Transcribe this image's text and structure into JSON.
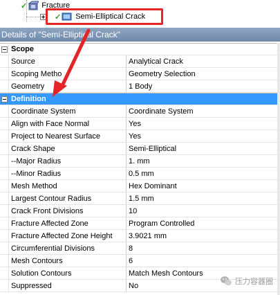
{
  "tree": {
    "parent_label": "Fracture",
    "child_label": "Semi-Elliptical Crack"
  },
  "details": {
    "title": "Details of \"Semi-Elliptical Crack\""
  },
  "groups": {
    "scope": "Scope",
    "definition": "Definition"
  },
  "scope_rows": [
    {
      "name": "Source",
      "value": "Analytical Crack"
    },
    {
      "name": "Scoping Metho",
      "value": "Geometry Selection"
    },
    {
      "name": "Geometry",
      "value": "1 Body"
    }
  ],
  "definition_rows": [
    {
      "name": "Coordinate System",
      "value": "Coordinate System"
    },
    {
      "name": "Align with Face Normal",
      "value": "Yes"
    },
    {
      "name": "Project to Nearest Surface",
      "value": "Yes"
    },
    {
      "name": "Crack Shape",
      "value": "Semi-Elliptical"
    },
    {
      "name": "--Major Radius",
      "value": "1. mm"
    },
    {
      "name": "--Minor Radius",
      "value": "0.5 mm"
    },
    {
      "name": "Mesh Method",
      "value": "Hex Dominant"
    },
    {
      "name": "Largest Contour Radius",
      "value": "1.5 mm"
    },
    {
      "name": "Crack Front Divisions",
      "value": "10"
    },
    {
      "name": "Fracture Affected Zone",
      "value": "Program Controlled"
    },
    {
      "name": "Fracture Affected Zone Height",
      "value": "3.9021 mm"
    },
    {
      "name": "Circumferential Divisions",
      "value": "8"
    },
    {
      "name": "Mesh Contours",
      "value": "6"
    },
    {
      "name": "Solution Contours",
      "value": "Match Mesh Contours"
    },
    {
      "name": "Suppressed",
      "value": "No"
    }
  ],
  "watermark": "压力容器圈",
  "icons": {
    "fracture": "fracture-folder-icon",
    "crack": "crack-icon",
    "check": "check-icon",
    "wechat": "wechat-icon"
  },
  "colors": {
    "selected_row": "#3399ff",
    "title_bar": "#7f97b8",
    "annotation_red": "#e42525"
  }
}
